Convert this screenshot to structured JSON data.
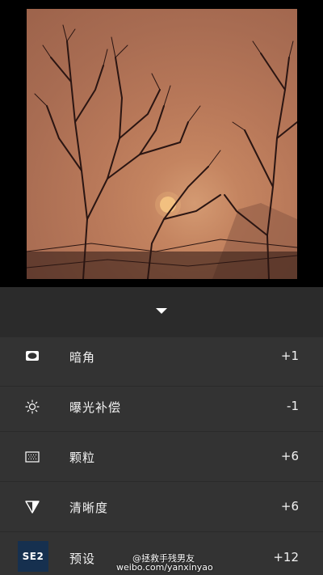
{
  "adjustments": [
    {
      "icon": "vignette-icon",
      "label": "暗角",
      "value": "+1"
    },
    {
      "icon": "exposure-icon",
      "label": "曝光补偿",
      "value": "-1"
    },
    {
      "icon": "grain-icon",
      "label": "颗粒",
      "value": "+6"
    },
    {
      "icon": "sharpness-icon",
      "label": "清晰度",
      "value": "+6"
    },
    {
      "icon": "preset-badge",
      "label": "预设",
      "value": "+12",
      "badge": "SE2"
    }
  ],
  "watermark": {
    "line1": "@拯救手残男友",
    "line2": "weibo.com/yanxinyao"
  },
  "colors": {
    "panel": "#333333",
    "collapse_bar": "#2b2b2b",
    "preset_badge": "#16304f"
  }
}
